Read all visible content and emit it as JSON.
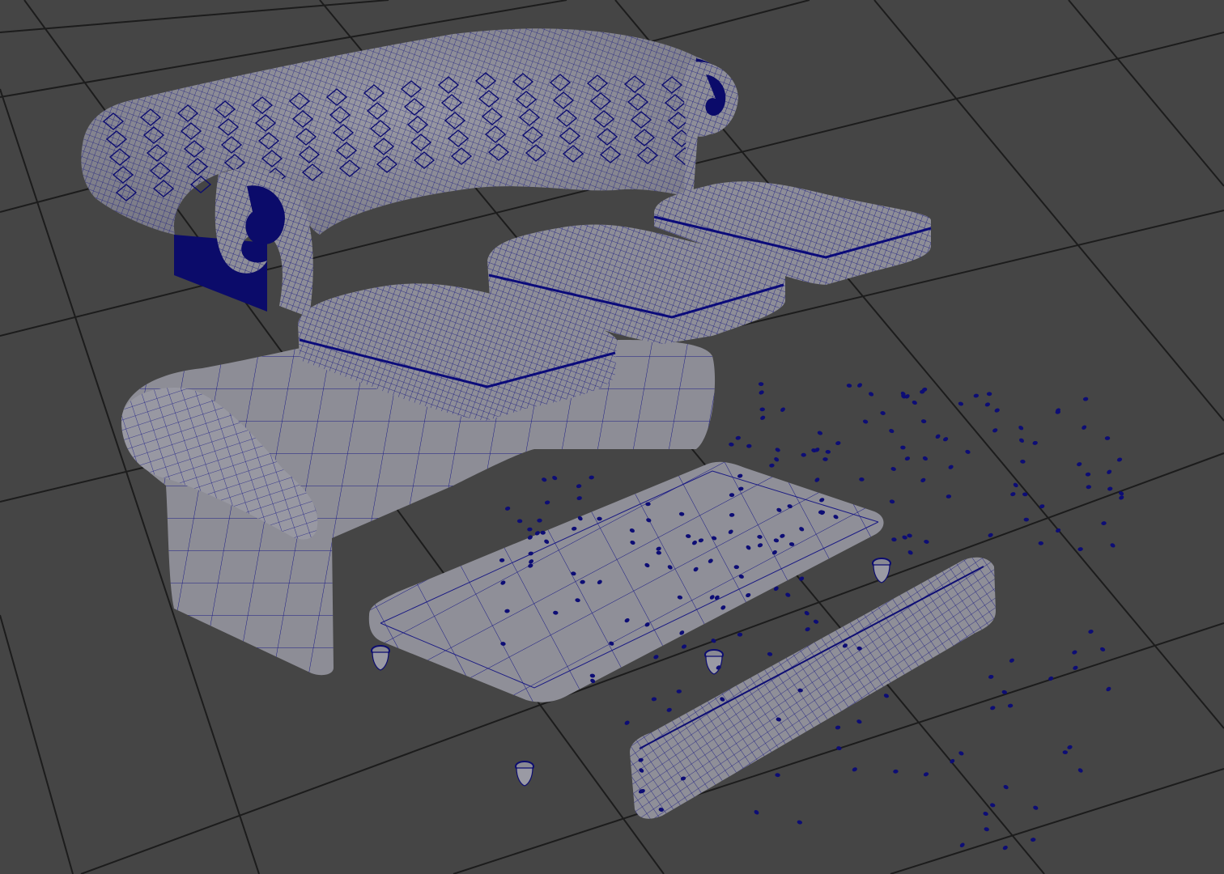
{
  "viewport": {
    "background": "#454545",
    "grid_color": "#1c1c1c",
    "mesh_fill": "#8e8e96",
    "mesh_fill_dark": "#6f6f78",
    "wire_color": "#0a0a78",
    "wire_dense_color": "#121290"
  },
  "scene": {
    "objects": [
      {
        "name": "tufted-backrest",
        "kind": "mesh"
      },
      {
        "name": "sofa-base",
        "kind": "mesh"
      },
      {
        "name": "seat-cushion-1",
        "kind": "mesh"
      },
      {
        "name": "seat-cushion-2",
        "kind": "mesh"
      },
      {
        "name": "seat-cushion-3",
        "kind": "mesh"
      },
      {
        "name": "bottom-platform",
        "kind": "mesh"
      },
      {
        "name": "tufted-front-rail",
        "kind": "mesh"
      },
      {
        "name": "bun-foot",
        "kind": "mesh",
        "count": 4
      },
      {
        "name": "tufting-buttons",
        "kind": "mesh-scatter"
      }
    ]
  }
}
